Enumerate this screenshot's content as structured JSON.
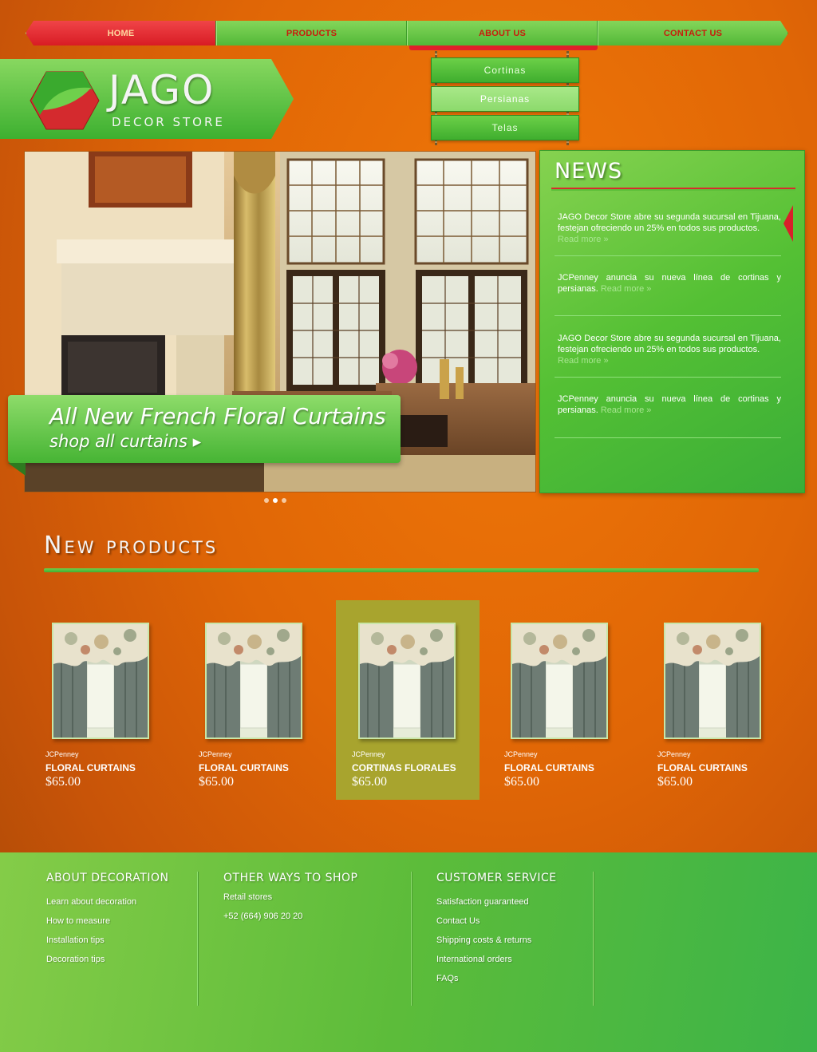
{
  "nav": {
    "items": [
      {
        "label": "HOME",
        "active": true
      },
      {
        "label": "PRODUCTS",
        "active": false
      },
      {
        "label": "ABOUT US",
        "active": false
      },
      {
        "label": "CONTACT US",
        "active": false
      }
    ]
  },
  "dropdown": {
    "items": [
      {
        "label": "Cortinas"
      },
      {
        "label": "Persianas",
        "hover": true
      },
      {
        "label": "Telas"
      }
    ]
  },
  "logo": {
    "title": "JAGO",
    "subtitle": "DECOR STORE"
  },
  "hero": {
    "banner_title": "All New French Floral Curtains",
    "banner_link": "shop all curtains ▸",
    "dots": 3,
    "active_dot": 2
  },
  "news": {
    "title": "NEWS",
    "read_more": "Read more »",
    "items": [
      {
        "text": "JAGO Decor Store abre su segunda sucursal en Tijuana, festejan ofreciendo un 25% en todos sus productos."
      },
      {
        "text": "JCPenney anuncia su nueva línea de cortinas y persianas."
      },
      {
        "text": "JAGO Decor Store abre su segunda sucursal en Tijuana, festejan ofreciendo un 25% en todos sus productos."
      },
      {
        "text": "JCPenney anuncia su nueva línea de cortinas y persianas."
      }
    ]
  },
  "new_products": {
    "title": "New products",
    "items": [
      {
        "brand": "JCPenney",
        "name": "FLORAL CURTAINS",
        "price": "$65.00",
        "active": false
      },
      {
        "brand": "JCPenney",
        "name": "FLORAL CURTAINS",
        "price": "$65.00",
        "active": false
      },
      {
        "brand": "JCPenney",
        "name": "CORTINAS FLORALES",
        "price": "$65.00",
        "active": true
      },
      {
        "brand": "JCPenney",
        "name": "FLORAL CURTAINS",
        "price": "$65.00",
        "active": false
      },
      {
        "brand": "JCPenney",
        "name": "FLORAL CURTAINS",
        "price": "$65.00",
        "active": false
      }
    ]
  },
  "footer": {
    "about": {
      "heading": "ABOUT DECORATION",
      "links": [
        "Learn about decoration",
        "How to measure",
        "Installation tips",
        "Decoration tips"
      ]
    },
    "shop": {
      "heading": "OTHER WAYS TO SHOP",
      "links": [
        "Retail stores",
        "+52 (664) 906 20 20"
      ]
    },
    "service": {
      "heading": "CUSTOMER SERVICE",
      "links": [
        "Satisfaction guaranteed",
        "Contact Us",
        "Shipping costs & returns",
        "International orders",
        "FAQs"
      ]
    }
  },
  "colors": {
    "background": "#e06606",
    "green": "#52b838",
    "red": "#d81c24"
  }
}
